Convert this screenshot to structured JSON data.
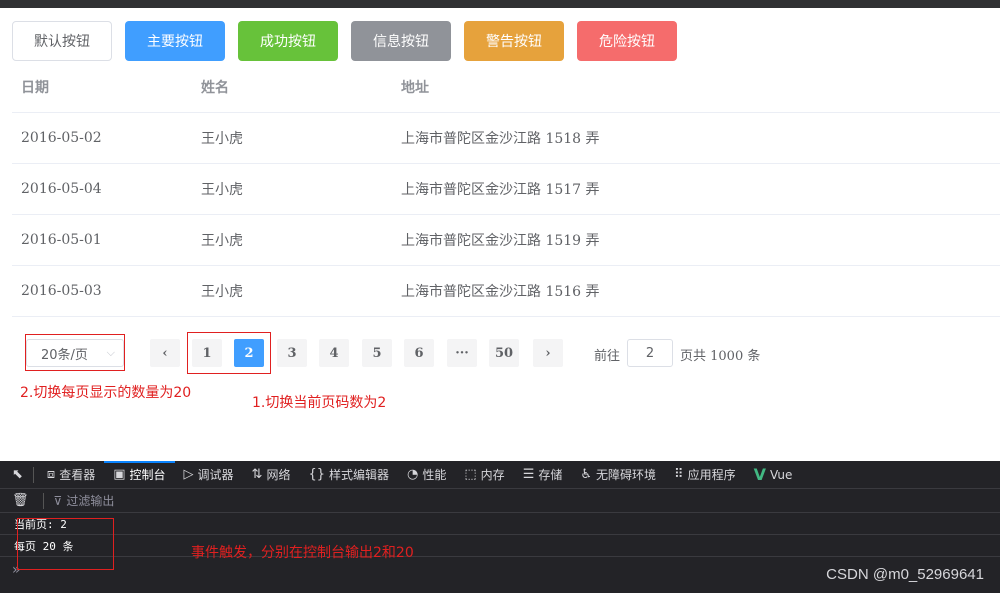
{
  "buttons": [
    {
      "label": "默认按钮"
    },
    {
      "label": "主要按钮"
    },
    {
      "label": "成功按钮"
    },
    {
      "label": "信息按钮"
    },
    {
      "label": "警告按钮"
    },
    {
      "label": "危险按钮"
    }
  ],
  "table": {
    "headers": [
      "日期",
      "姓名",
      "地址"
    ],
    "rows": [
      [
        "2016-05-02",
        "王小虎",
        "上海市普陀区金沙江路 1518 弄"
      ],
      [
        "2016-05-04",
        "王小虎",
        "上海市普陀区金沙江路 1517 弄"
      ],
      [
        "2016-05-01",
        "王小虎",
        "上海市普陀区金沙江路 1519 弄"
      ],
      [
        "2016-05-03",
        "王小虎",
        "上海市普陀区金沙江路 1516 弄"
      ]
    ]
  },
  "pagination": {
    "page_size": "20条/页",
    "prev": "‹",
    "next": "›",
    "pages": [
      "1",
      "2",
      "3",
      "4",
      "5",
      "6",
      "···",
      "50"
    ],
    "current": "2",
    "jump_label": "前往",
    "jump_value": "2",
    "total": "页共 1000 条"
  },
  "annotations": {
    "size_note": "2.切换每页显示的数量为20",
    "page_note": "1.切换当前页码数为2",
    "event_note": "事件触发，分别在控制台输出2和20"
  },
  "devtools": {
    "tabs": [
      {
        "icon": "⧈",
        "label": "查看器"
      },
      {
        "icon": "▣",
        "label": "控制台"
      },
      {
        "icon": "▷",
        "label": "调试器"
      },
      {
        "icon": "⇅",
        "label": "网络"
      },
      {
        "icon": "{}",
        "label": "样式编辑器"
      },
      {
        "icon": "◔",
        "label": "性能"
      },
      {
        "icon": "⬚",
        "label": "内存"
      },
      {
        "icon": "☰",
        "label": "存储"
      },
      {
        "icon": "♿",
        "label": "无障碍环境"
      },
      {
        "icon": "⠿",
        "label": "应用程序"
      },
      {
        "icon": "V",
        "label": "Vue"
      }
    ],
    "filter_placeholder": "过滤输出",
    "log_lines": [
      "当前页: 2",
      "每页 20 条"
    ],
    "prompt": "»"
  },
  "watermark": "CSDN @m0_52969641",
  "colors": {
    "primary": "#409eff",
    "success": "#67c23a",
    "info": "#909399",
    "warning": "#e6a23c",
    "danger": "#f56c6c",
    "annotation": "#e02020"
  }
}
